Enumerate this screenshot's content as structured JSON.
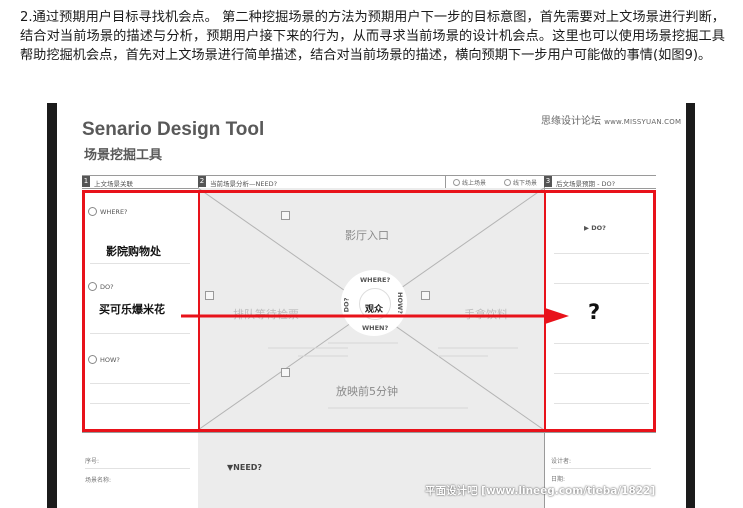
{
  "article": {
    "text": "2.通过预期用户目标寻找机会点。 第二种挖掘场景的方法为预期用户下一步的目标意图，首先需要对上文场景进行判断，结合对当前场景的描述与分析，预期用户接下来的行为，从而寻求当前场景的设计机会点。这里也可以使用场景挖掘工具帮助挖掘机会点，首先对上文场景进行简单描述，结合对当前场景的描述，横向预期下一步用户可能做的事情(如图9)。"
  },
  "figure": {
    "title_en": "Senario Design Tool",
    "title_cn": "场景挖掘工具",
    "brand_cn": "思缘设计论坛",
    "brand_url": "www.MISSYUAN.COM",
    "columns": [
      {
        "num": "1",
        "label": "上文场景关联"
      },
      {
        "num": "2",
        "label": "当前场景分析—NEED?"
      },
      {
        "num": "3",
        "label": "后文场景预期 - DO?"
      }
    ],
    "radios": [
      "线上场景",
      "线下场景"
    ],
    "left": {
      "where_label": "WHERE?",
      "where_value": "影院购物处",
      "do_label": "DO?",
      "do_value": "买可乐爆米花",
      "how_label": "HOW?"
    },
    "middle": {
      "top": "影厅入口",
      "left": "排队等待检票",
      "right": "手拿饮料",
      "bottom": "放映前5分钟",
      "center": "观众",
      "wheel": [
        "WHERE?",
        "HOW?",
        "WHEN?",
        "DO?"
      ]
    },
    "right": {
      "do_label": "▶ DO?",
      "answer": "?"
    },
    "footer": {
      "serial": "序号:",
      "scene_name": "场景名称:",
      "need": "▼NEED?",
      "designer": "设计者:",
      "date": "日期:"
    },
    "colors": {
      "highlight": "#e8121a",
      "panel": "#ececec",
      "frame": "#1b1b1b"
    }
  },
  "watermark": "平面设计吧 [www.lineeg.com/tieba/1822]"
}
